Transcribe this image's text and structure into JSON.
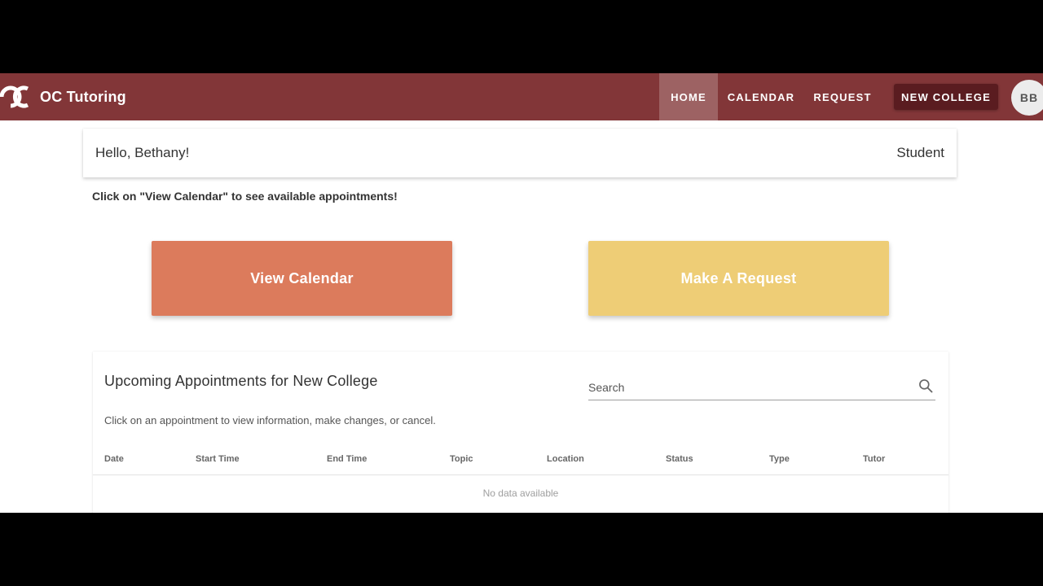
{
  "app": {
    "title": "OC Tutoring",
    "nav": {
      "home": "HOME",
      "calendar": "CALENDAR",
      "request": "REQUEST",
      "college": "NEW COLLEGE",
      "avatar_initials": "BB"
    }
  },
  "greeting": {
    "hello": "Hello, Bethany!",
    "role": "Student"
  },
  "hint": "Click on \"View Calendar\" to see available appointments!",
  "actions": {
    "view_calendar": "View Calendar",
    "make_request": "Make A Request"
  },
  "appointments": {
    "title": "Upcoming Appointments for New College",
    "description": "Click on an appointment to view information, make changes, or cancel.",
    "search_placeholder": "Search",
    "columns": [
      "Date",
      "Start Time",
      "End Time",
      "Topic",
      "Location",
      "Status",
      "Type",
      "Tutor"
    ],
    "empty_message": "No data available"
  },
  "colors": {
    "topbar": "#823638",
    "college_button": "#5a1c20",
    "view_calendar": "#dc7b5c",
    "make_request": "#eecd76"
  },
  "icons": {
    "logo": "oc-logo-icon",
    "search": "search-icon"
  }
}
